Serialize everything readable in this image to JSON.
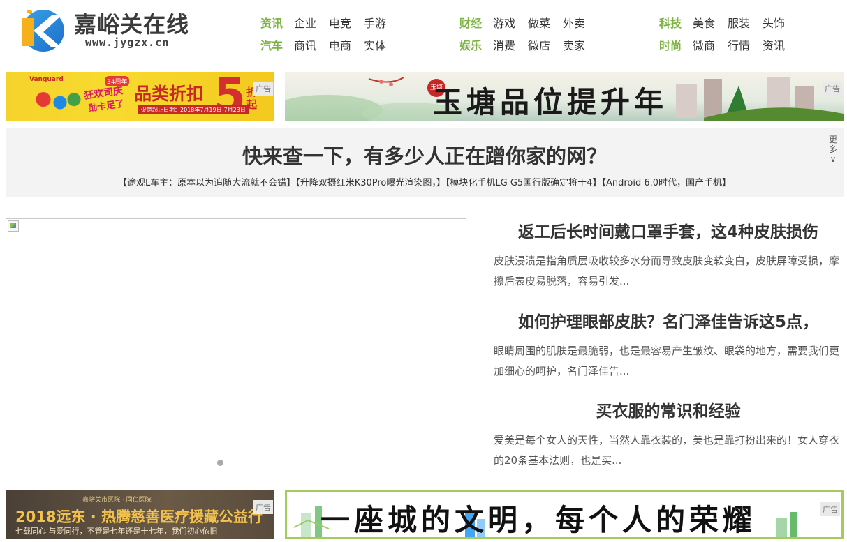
{
  "header": {
    "logo_title": "嘉峪关在线",
    "logo_url": "www.jygzx.cn",
    "nav_groups": [
      {
        "rows": [
          {
            "cat": "资讯",
            "items": [
              "企业",
              "电竞",
              "手游"
            ]
          },
          {
            "cat": "汽车",
            "items": [
              "商讯",
              "电商",
              "实体"
            ]
          }
        ]
      },
      {
        "rows": [
          {
            "cat": "财经",
            "items": [
              "游戏",
              "做菜",
              "外卖"
            ]
          },
          {
            "cat": "娱乐",
            "items": [
              "消费",
              "微店",
              "卖家"
            ]
          }
        ]
      },
      {
        "rows": [
          {
            "cat": "科技",
            "items": [
              "美食",
              "服装",
              "头饰"
            ]
          },
          {
            "cat": "时尚",
            "items": [
              "微商",
              "行情",
              "资讯"
            ]
          }
        ]
      }
    ]
  },
  "ads": {
    "tag": "广告",
    "ad1": {
      "badge": "34周年",
      "brand": "Vanguard",
      "slogan": "狂欢司庆",
      "slogan2": "勋卡足了",
      "main": "品类折扣",
      "num": "5",
      "suffix": "折起",
      "date": "促销起止日期：2018年7月19日-7月23日"
    },
    "ad2": {
      "seal": "玉塘",
      "text": "玉塘品位提升年"
    },
    "ad3": {
      "top": "嘉峪关市医院 · 同仁医院",
      "main": "2018远东 · 热腾慈善医疗援藏公益行",
      "sub": "七载同心 与爱同行，不管是七年还是十七年，我们初心依旧"
    },
    "ad4": {
      "text": "一座城的文明，每个人的荣耀"
    }
  },
  "headline": {
    "title": "快来查一下，有多少人正在蹭你家的网？",
    "links": [
      "【途观L车主：原本以为追随大流就不会错】",
      "【升降双摄红米K30Pro曝光渲染图，】",
      "【模块化手机LG G5国行版确定将于4】",
      "【Android 6.0时代，国产手机】"
    ],
    "more_label": "更多",
    "more_arrow": "∨"
  },
  "articles": [
    {
      "title": "返工后长时间戴口罩手套，这4种皮肤损伤",
      "summary": "皮肤浸渍是指角质层吸收较多水分而导致皮肤变软变白，皮肤屏障受损，摩擦后表皮易脱落，容易引发..."
    },
    {
      "title": "如何护理眼部皮肤？名门泽佳告诉这5点，",
      "summary": "眼睛周围的肌肤是最脆弱，也是最容易产生皱纹、眼袋的地方，需要我们更加细心的呵护，名门泽佳告..."
    },
    {
      "title": "买衣服的常识和经验",
      "summary": "爱美是每个女人的天性，当然人靠衣装的，美也是靠打扮出来的！女人穿衣的20条基本法则，也是买..."
    }
  ],
  "colors": {
    "accent_green": "#7cb342",
    "ad4_border": "#a6cb5b"
  }
}
